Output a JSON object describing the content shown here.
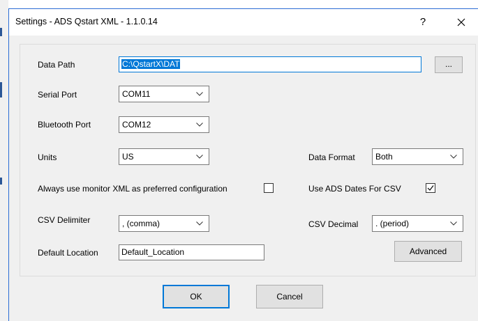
{
  "window": {
    "title": "Settings - ADS Qstart XML - 1.1.0.14",
    "help_glyph": "?"
  },
  "data_path": {
    "label": "Data Path",
    "value": "C:\\QstartX\\DAT",
    "browse_label": "..."
  },
  "serial_port": {
    "label": "Serial Port",
    "value": "COM11"
  },
  "bluetooth_port": {
    "label": "Bluetooth Port",
    "value": "COM12"
  },
  "units": {
    "label": "Units",
    "value": "US"
  },
  "data_format": {
    "label": "Data Format",
    "value": "Both"
  },
  "monitor_xml": {
    "label": "Always use monitor XML as preferred configuration",
    "checked": false
  },
  "ads_dates": {
    "label": "Use ADS Dates For CSV",
    "checked": true
  },
  "csv_delimiter": {
    "label": "CSV Delimiter",
    "value": ", (comma)"
  },
  "csv_decimal": {
    "label": "CSV Decimal",
    "value": ". (period)"
  },
  "default_location": {
    "label": "Default Location",
    "value": "Default_Location"
  },
  "buttons": {
    "advanced": "Advanced",
    "ok": "OK",
    "cancel": "Cancel"
  },
  "colors": {
    "accent": "#0078d7",
    "dialog_bg": "#f0f0f0"
  }
}
